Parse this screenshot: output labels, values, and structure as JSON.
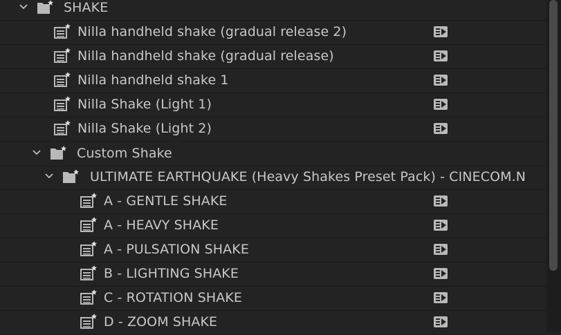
{
  "folders": {
    "shake": "SHAKE",
    "custom_shake": "Custom Shake",
    "ultimate": "ULTIMATE EARTHQUAKE (Heavy Shakes Preset Pack) - CINECOM.N"
  },
  "presets": {
    "shake_items": [
      "Nilla handheld shake (gradual release 2)",
      "Nilla handheld shake (gradual release)",
      "Nilla handheld shake 1",
      "Nilla Shake (Light 1)",
      "Nilla Shake (Light 2)"
    ],
    "ultimate_items": [
      "A - GENTLE SHAKE",
      "A - HEAVY SHAKE",
      "A - PULSATION SHAKE",
      "B - LIGHTING SHAKE",
      "C - ROTATION SHAKE",
      "D - ZOOM SHAKE"
    ]
  },
  "icons": {
    "chevron": "chevron-down-icon",
    "folder": "preset-folder-icon",
    "preset": "preset-icon",
    "effect_badge": "effect-type-icon"
  },
  "colors": {
    "background": "#232323",
    "text": "#c8c8c8",
    "icon": "#b9b9b9",
    "divider": "#1a1a1a"
  }
}
